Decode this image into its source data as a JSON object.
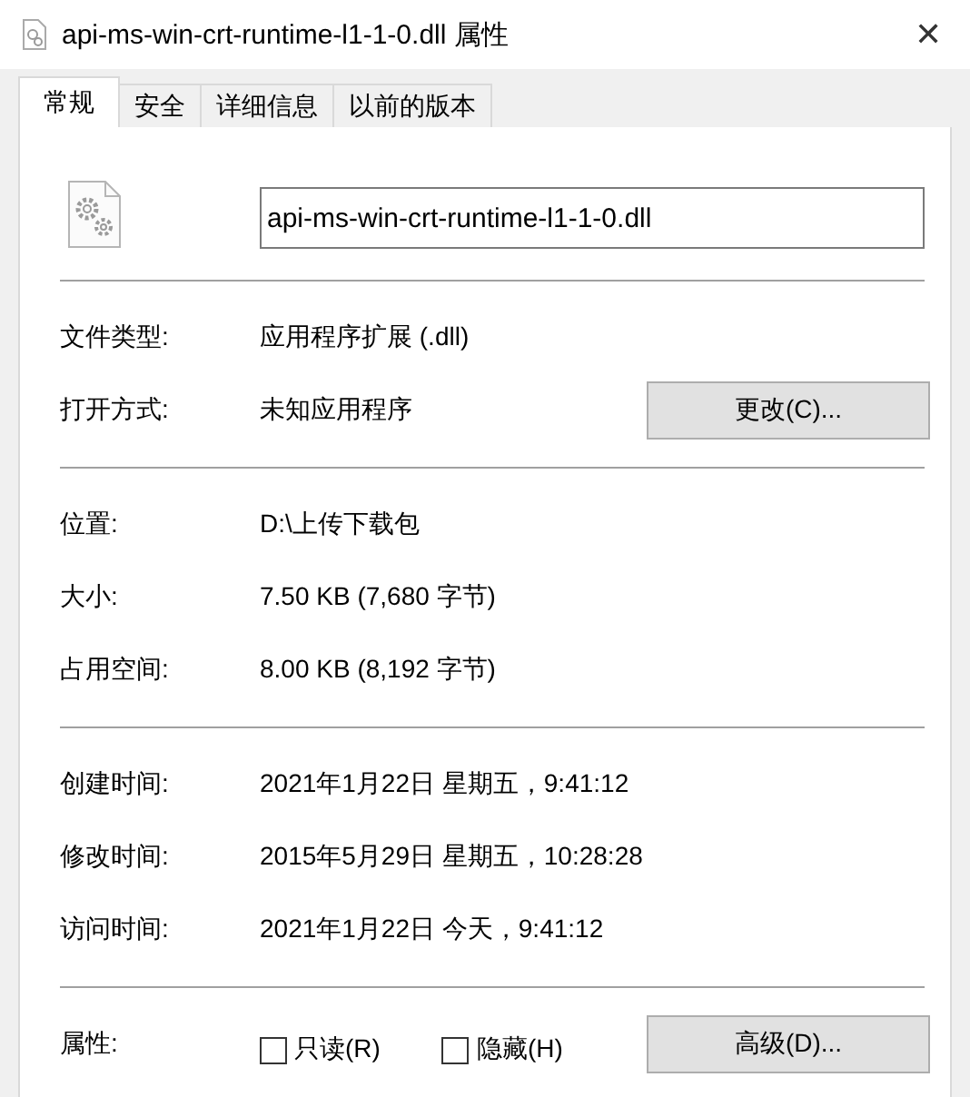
{
  "window": {
    "title": "api-ms-win-crt-runtime-l1-1-0.dll 属性",
    "close": "✕"
  },
  "tabs": [
    {
      "label": "常规",
      "selected": true
    },
    {
      "label": "安全",
      "selected": false
    },
    {
      "label": "详细信息",
      "selected": false
    },
    {
      "label": "以前的版本",
      "selected": false
    }
  ],
  "file_name": "api-ms-win-crt-runtime-l1-1-0.dll",
  "sections": [
    [
      {
        "label": "文件类型:",
        "value": "应用程序扩展 (.dll)"
      },
      {
        "label": "打开方式:",
        "value": "未知应用程序",
        "button": "更改(C)..."
      }
    ],
    [
      {
        "label": "位置:",
        "value": "D:\\上传下载包"
      },
      {
        "label": "大小:",
        "value": "7.50 KB (7,680 字节)"
      },
      {
        "label": "占用空间:",
        "value": "8.00 KB (8,192 字节)"
      }
    ],
    [
      {
        "label": "创建时间:",
        "value": "2021年1月22日 星期五，9:41:12"
      },
      {
        "label": "修改时间:",
        "value": "2015年5月29日 星期五，10:28:28"
      },
      {
        "label": "访问时间:",
        "value": "2021年1月22日 今天，9:41:12"
      }
    ]
  ],
  "attributes": {
    "label": "属性:",
    "checkboxes": [
      {
        "label": "只读(R)",
        "checked": false
      },
      {
        "label": "隐藏(H)",
        "checked": false
      }
    ],
    "button": "高级(D)..."
  }
}
